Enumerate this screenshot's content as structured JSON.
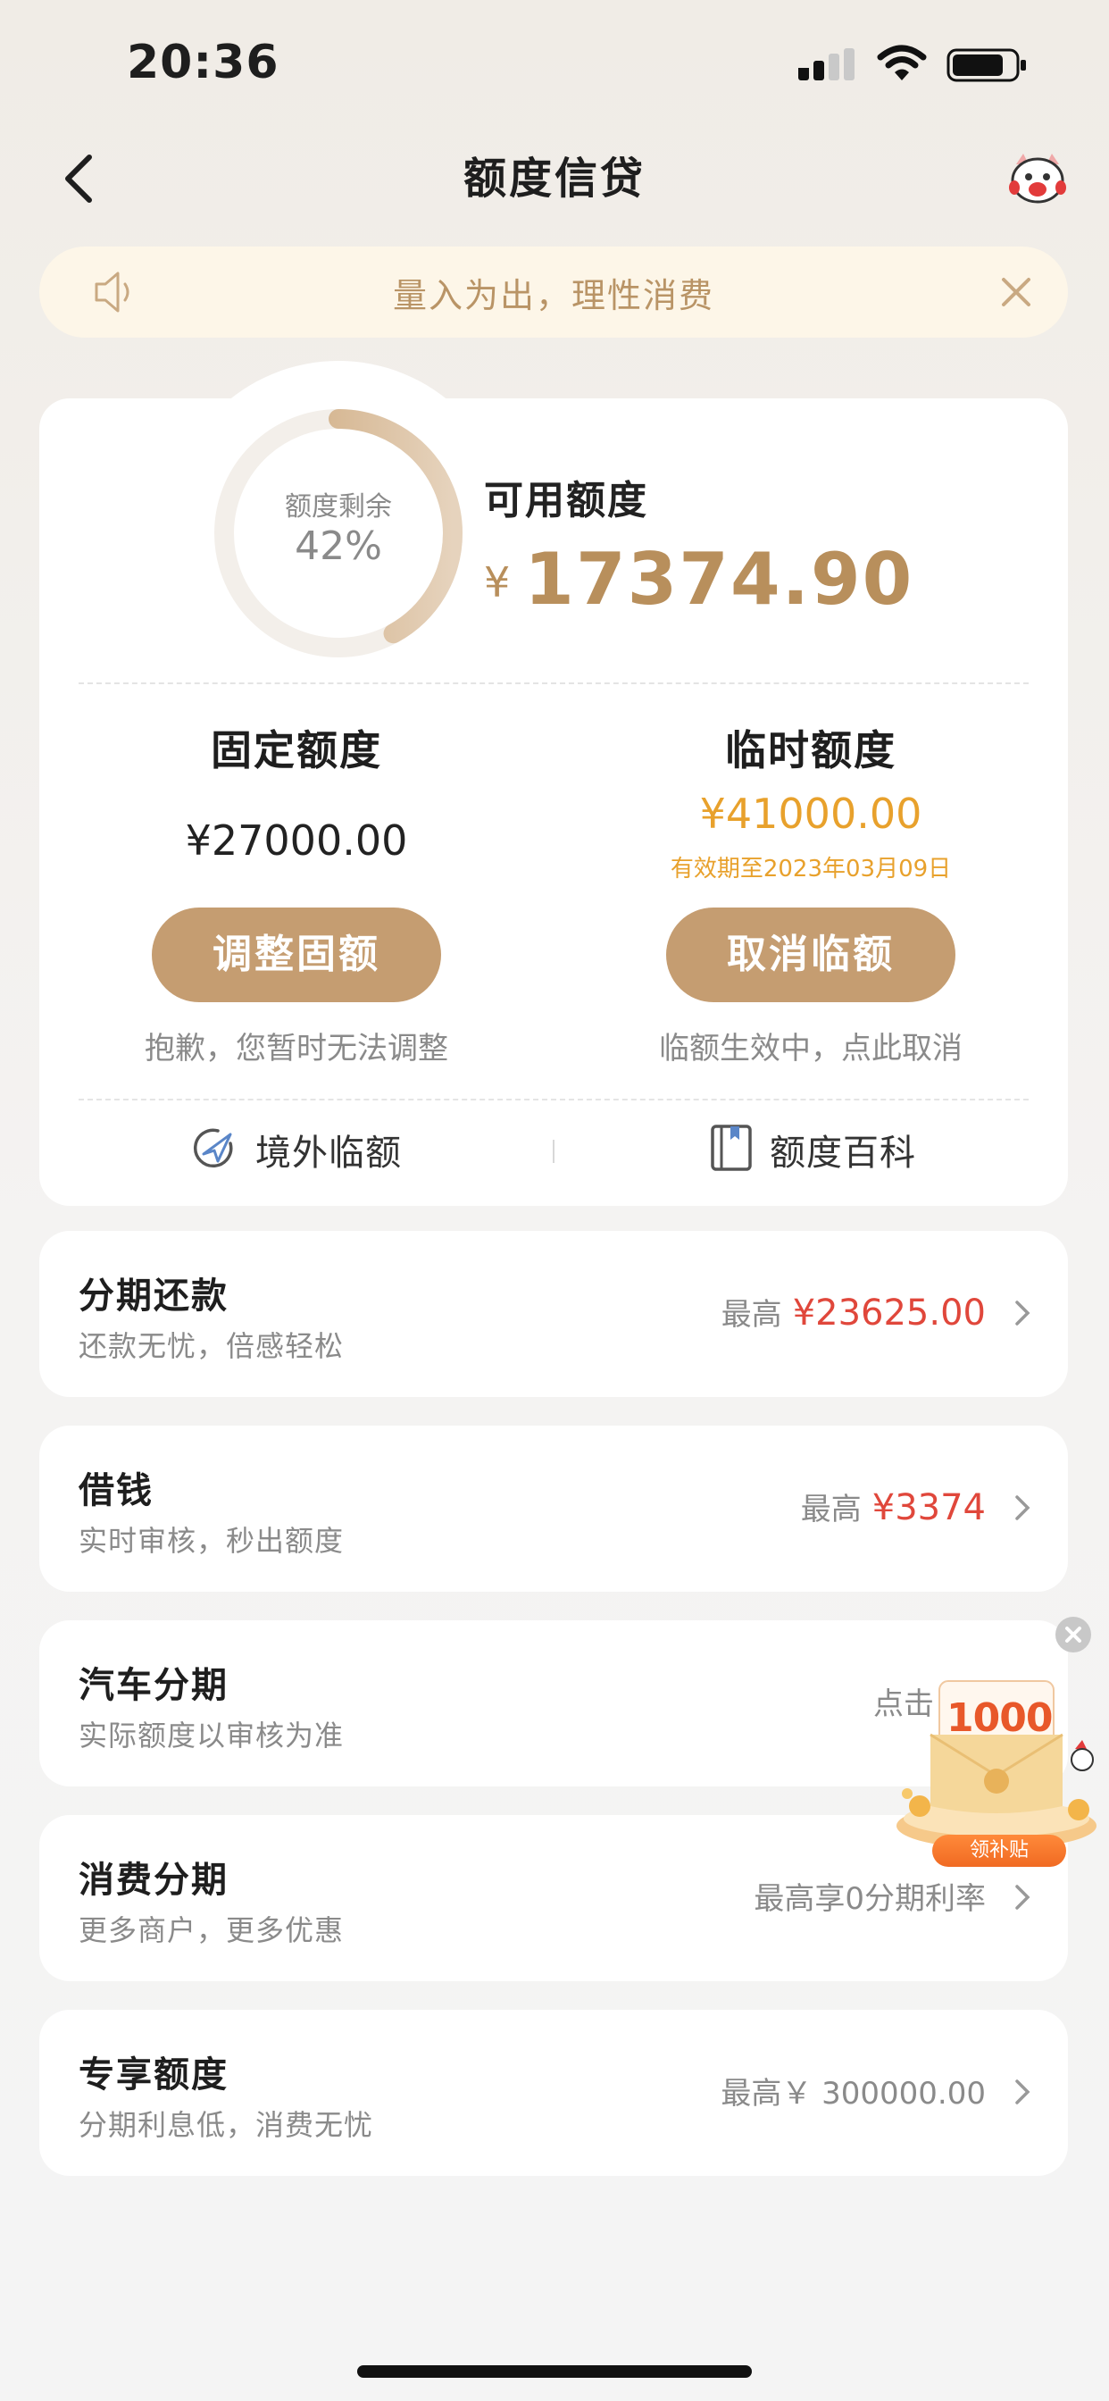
{
  "status_bar": {
    "time": "20:36"
  },
  "nav": {
    "title": "额度信贷"
  },
  "notice": {
    "text": "量入为出，理性消费"
  },
  "credit": {
    "ring_label": "额度剩余",
    "ring_percent": "42%",
    "remaining_fraction": 0.42,
    "available_label": "可用额度",
    "currency": "¥",
    "available_amount": "17374.90",
    "fixed": {
      "title": "固定额度",
      "amount": "¥27000.00",
      "button": "调整固额",
      "hint": "抱歉，您暂时无法调整"
    },
    "temporary": {
      "title": "临时额度",
      "amount": "¥41000.00",
      "validity": "有效期至2023年03月09日",
      "button": "取消临额",
      "hint": "临额生效中，点此取消"
    },
    "links": {
      "overseas": "境外临额",
      "wiki": "额度百科"
    }
  },
  "services": [
    {
      "title": "分期还款",
      "subtitle": "还款无忧，倍感轻松",
      "prefix": "最高",
      "amount": "¥23625.00"
    },
    {
      "title": "借钱",
      "subtitle": "实时审核，秒出额度",
      "prefix": "最高",
      "amount": "¥3374"
    },
    {
      "title": "汽车分期",
      "subtitle": "实际额度以审核为准",
      "prefix": "点击",
      "amount": ""
    },
    {
      "title": "消费分期",
      "subtitle": "更多商户，更多优惠",
      "prefix": "最高享0分期利率",
      "amount": ""
    },
    {
      "title": "专享额度",
      "subtitle": "分期利息低，消费无忧",
      "prefix": "最高￥ 300000.00",
      "amount": ""
    }
  ],
  "promo": {
    "amount": "1000",
    "tag": "领补贴"
  },
  "colors": {
    "accent": "#c59d71",
    "gold_text": "#b88f5c",
    "temp_orange": "#e8a12c",
    "red_amount": "#e0473b"
  }
}
